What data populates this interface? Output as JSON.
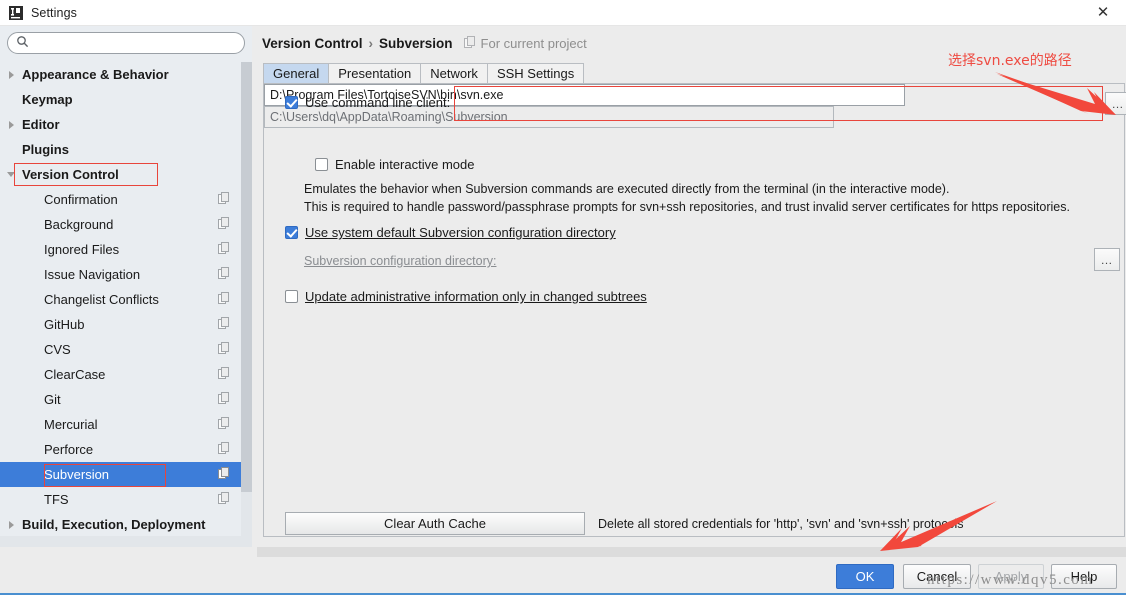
{
  "window": {
    "title": "Settings",
    "app_icon": "intellij-idea-icon",
    "close_label": "✕"
  },
  "search": {
    "value": "",
    "placeholder": "",
    "icon": "search-icon"
  },
  "sidebar": {
    "items": [
      {
        "label": "Appearance & Behavior",
        "indent": 0,
        "twisty": "right",
        "bold": true,
        "copy": false,
        "selected": false
      },
      {
        "label": "Keymap",
        "indent": 0,
        "twisty": "none",
        "bold": true,
        "copy": false,
        "selected": false
      },
      {
        "label": "Editor",
        "indent": 0,
        "twisty": "right",
        "bold": true,
        "copy": false,
        "selected": false
      },
      {
        "label": "Plugins",
        "indent": 0,
        "twisty": "none",
        "bold": true,
        "copy": false,
        "selected": false
      },
      {
        "label": "Version Control",
        "indent": 0,
        "twisty": "down",
        "bold": true,
        "copy": false,
        "selected": false
      },
      {
        "label": "Confirmation",
        "indent": 1,
        "twisty": "none",
        "bold": false,
        "copy": true,
        "selected": false
      },
      {
        "label": "Background",
        "indent": 1,
        "twisty": "none",
        "bold": false,
        "copy": true,
        "selected": false
      },
      {
        "label": "Ignored Files",
        "indent": 1,
        "twisty": "none",
        "bold": false,
        "copy": true,
        "selected": false
      },
      {
        "label": "Issue Navigation",
        "indent": 1,
        "twisty": "none",
        "bold": false,
        "copy": true,
        "selected": false
      },
      {
        "label": "Changelist Conflicts",
        "indent": 1,
        "twisty": "none",
        "bold": false,
        "copy": true,
        "selected": false
      },
      {
        "label": "GitHub",
        "indent": 1,
        "twisty": "none",
        "bold": false,
        "copy": true,
        "selected": false
      },
      {
        "label": "CVS",
        "indent": 1,
        "twisty": "none",
        "bold": false,
        "copy": true,
        "selected": false
      },
      {
        "label": "ClearCase",
        "indent": 1,
        "twisty": "none",
        "bold": false,
        "copy": true,
        "selected": false
      },
      {
        "label": "Git",
        "indent": 1,
        "twisty": "none",
        "bold": false,
        "copy": true,
        "selected": false
      },
      {
        "label": "Mercurial",
        "indent": 1,
        "twisty": "none",
        "bold": false,
        "copy": true,
        "selected": false
      },
      {
        "label": "Perforce",
        "indent": 1,
        "twisty": "none",
        "bold": false,
        "copy": true,
        "selected": false
      },
      {
        "label": "Subversion",
        "indent": 1,
        "twisty": "none",
        "bold": false,
        "copy": true,
        "selected": true
      },
      {
        "label": "TFS",
        "indent": 1,
        "twisty": "none",
        "bold": false,
        "copy": true,
        "selected": false
      },
      {
        "label": "Build, Execution, Deployment",
        "indent": 0,
        "twisty": "right",
        "bold": true,
        "copy": false,
        "selected": false
      }
    ]
  },
  "breadcrumb": {
    "parent": "Version Control",
    "separator": "›",
    "current": "Subversion",
    "scope_icon": "copy-icon",
    "scope_text": "For current project"
  },
  "tabs": [
    {
      "label": "General",
      "active": true
    },
    {
      "label": "Presentation",
      "active": false
    },
    {
      "label": "Network",
      "active": false
    },
    {
      "label": "SSH Settings",
      "active": false
    }
  ],
  "general": {
    "use_cli": {
      "label": "Use command line client:",
      "checked": true,
      "value": "D:\\Program Files\\TortoiseSVN\\bin\\svn.exe",
      "browse_label": "…"
    },
    "interactive": {
      "label": "Enable interactive mode",
      "checked": false
    },
    "description_line1": "Emulates the behavior when Subversion commands are executed directly from the terminal (in the interactive mode).",
    "description_line2": "This is required to handle password/passphrase prompts for svn+ssh repositories, and trust invalid server certificates for https repositories.",
    "use_system_default": {
      "label": "Use system default Subversion configuration directory",
      "checked": true
    },
    "config_dir": {
      "label": "Subversion configuration directory:",
      "value": "C:\\Users\\dq\\AppData\\Roaming\\Subversion",
      "browse_label": "…",
      "disabled": true
    },
    "update_admin": {
      "label": "Update administrative information only in changed subtrees",
      "checked": false
    },
    "clear_auth": {
      "button_label": "Clear Auth Cache",
      "description": "Delete all stored credentials for 'http', 'svn' and 'svn+ssh' protocols"
    }
  },
  "buttons": {
    "ok": "OK",
    "cancel": "Cancel",
    "apply": "Apply",
    "help": "Help"
  },
  "annotations": {
    "note": "选择svn.exe的路径",
    "watermark": "https://www.dqv5.com"
  },
  "colors": {
    "accent_blue": "#3d7dd9",
    "annotation_red": "#ee4b42",
    "panel_bg": "#ececec",
    "sidebar_bg": "#e9edf1",
    "tab_active": "#c5d8ef"
  }
}
